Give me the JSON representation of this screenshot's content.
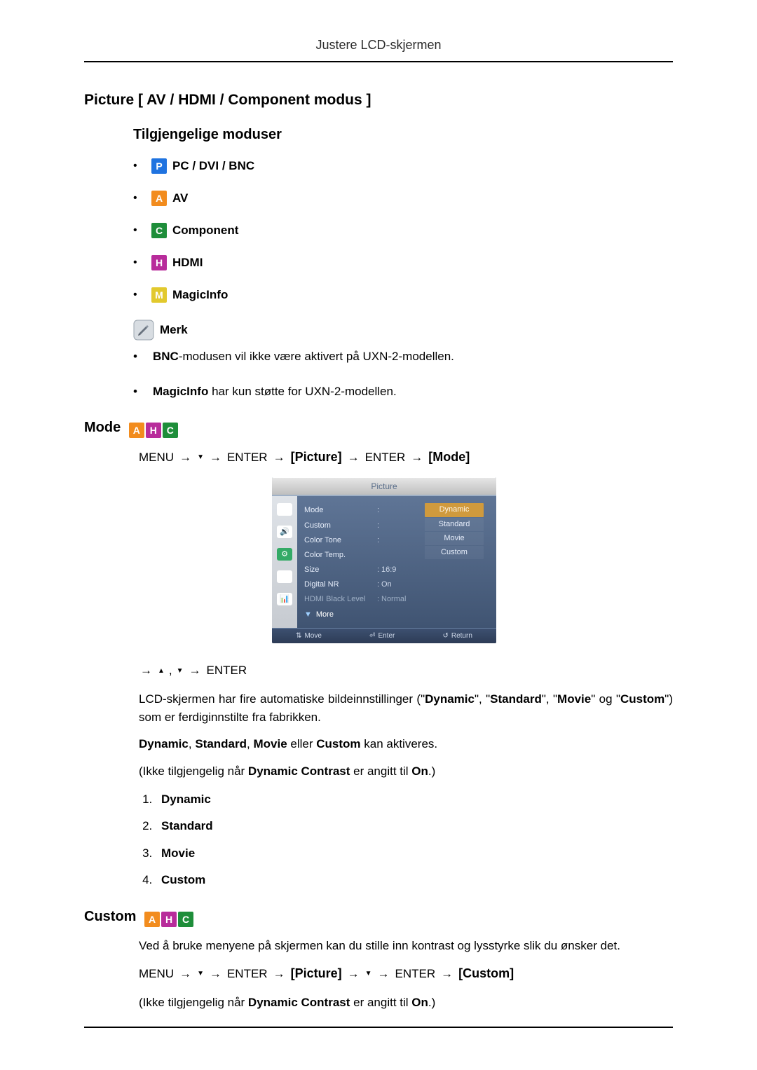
{
  "header": {
    "title": "Justere LCD-skjermen"
  },
  "section": {
    "title": "Picture [ AV / HDMI / Component modus ]"
  },
  "modes_heading": "Tilgjengelige moduser",
  "mode_badges": {
    "P": {
      "letter": "P",
      "label": "PC / DVI / BNC"
    },
    "A": {
      "letter": "A",
      "label": "AV"
    },
    "C": {
      "letter": "C",
      "label": "Component"
    },
    "H": {
      "letter": "H",
      "label": "HDMI"
    },
    "M": {
      "letter": "M",
      "label": "MagicInfo"
    }
  },
  "note": {
    "label": "Merk"
  },
  "note_items": [
    {
      "bold": "BNC",
      "rest": "-modusen vil ikke være aktivert på UXN-2-modellen."
    },
    {
      "bold": "MagicInfo",
      "rest": " har kun støtte for UXN-2-modellen."
    }
  ],
  "mode_section": {
    "title": "Mode"
  },
  "path1": {
    "menu": "MENU",
    "enter": "ENTER",
    "br_picture": "Picture",
    "br_mode": "Mode"
  },
  "osd": {
    "title": "Picture",
    "rows": [
      {
        "label": "Mode"
      },
      {
        "label": "Custom"
      },
      {
        "label": "Color Tone"
      },
      {
        "label": "Color Temp."
      },
      {
        "label": "Size",
        "value": "16:9"
      },
      {
        "label": "Digital NR",
        "value": "On"
      },
      {
        "label": "HDMI Black Level",
        "value": "Normal",
        "dim": true
      }
    ],
    "more": "More",
    "options": [
      "Dynamic",
      "Standard",
      "Movie",
      "Custom"
    ],
    "selected_option": 0,
    "bottom": {
      "move": "Move",
      "enter": "Enter",
      "return": "Return"
    }
  },
  "nav2": {
    "enter": "ENTER"
  },
  "body1": {
    "pre": "LCD-skjermen har fire automatiske bildeinnstillinger (\"",
    "opt1": "Dynamic",
    "mid1": "\", \"",
    "opt2": "Standard",
    "mid2": "\", \"",
    "opt3": "Movie",
    "mid3": "\" og \"",
    "opt4": "Custom",
    "post": "\") som er ferdiginnstilte fra fabrikken."
  },
  "body2": {
    "b1": "Dynamic",
    "c1": ", ",
    "b2": "Standard",
    "c2": ", ",
    "b3": "Movie",
    "c3": " eller ",
    "b4": "Custom",
    "c4": " kan aktiveres."
  },
  "body3": {
    "pre": "(Ikke tilgjengelig når ",
    "b1": "Dynamic Contrast",
    "mid": " er angitt til ",
    "b2": "On",
    "post": ".)"
  },
  "num_list": [
    "Dynamic",
    "Standard",
    "Movie",
    "Custom"
  ],
  "custom_section": {
    "title": "Custom",
    "body": "Ved å bruke menyene på skjermen kan du stille inn kontrast og lysstyrke slik du ønsker det."
  },
  "path2": {
    "menu": "MENU",
    "enter": "ENTER",
    "br_picture": "Picture",
    "br_custom": "Custom"
  },
  "body4": {
    "pre": "(Ikke tilgjengelig når ",
    "b1": "Dynamic Contrast",
    "mid": " er angitt til ",
    "b2": "On",
    "post": ".)"
  }
}
